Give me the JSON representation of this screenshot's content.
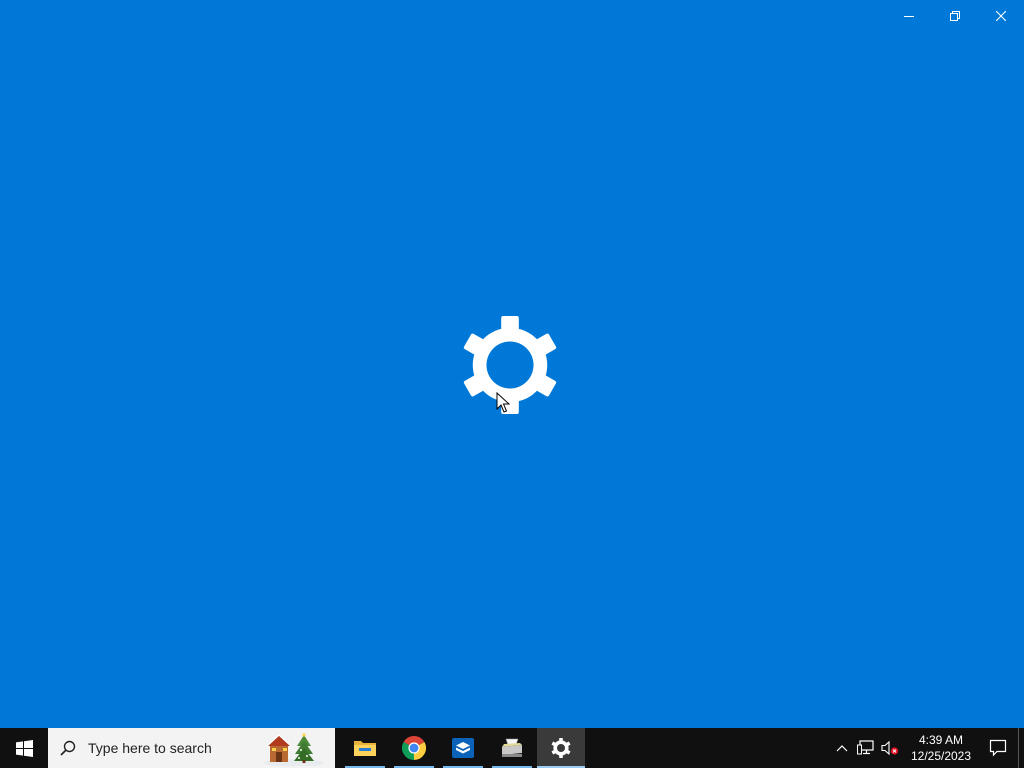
{
  "window": {
    "background_color": "#0078d7",
    "splash_icon": "settings-gear-icon",
    "controls": [
      "minimize-icon",
      "restore-icon",
      "close-icon"
    ]
  },
  "taskbar": {
    "background_color": "#101010",
    "start_icon": "windows-logo-icon",
    "search": {
      "placeholder": "Type here to search",
      "icon": "search-icon",
      "highlight_icon": "holiday-cabin-tree-icon"
    },
    "apps": [
      {
        "name": "File Explorer",
        "icon": "file-explorer-icon",
        "running": true,
        "active": false
      },
      {
        "name": "Google Chrome",
        "icon": "chrome-icon",
        "running": true,
        "active": false
      },
      {
        "name": "Sandbox",
        "icon": "sandbox-box-icon",
        "running": true,
        "active": false
      },
      {
        "name": "Scanner",
        "icon": "scanner-icon",
        "running": true,
        "active": false
      },
      {
        "name": "Settings",
        "icon": "settings-gear-icon",
        "running": true,
        "active": true
      }
    ],
    "tray": {
      "icons": [
        "chevron-up-icon",
        "network-icon",
        "volume-muted-icon"
      ],
      "time": "4:39 AM",
      "date": "12/25/2023",
      "notification_icon": "action-center-icon"
    }
  }
}
